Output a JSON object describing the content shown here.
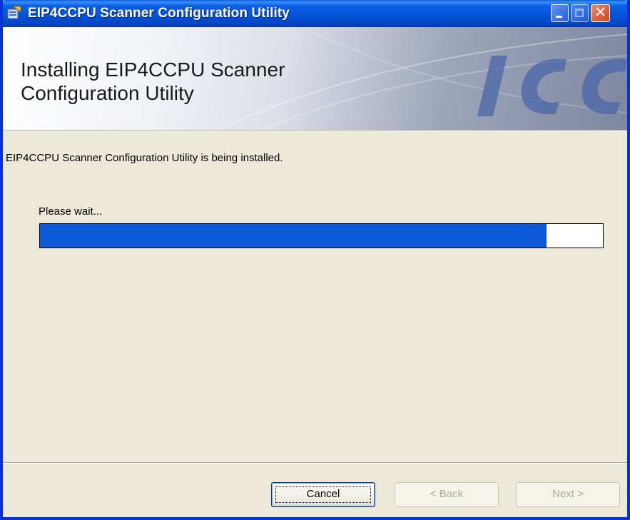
{
  "window": {
    "title": "EIP4CCPU Scanner Configuration Utility",
    "buttons": [
      "minimize",
      "maximize",
      "close"
    ]
  },
  "banner": {
    "title": "Installing EIP4CCPU Scanner Configuration Utility",
    "logo_icon": "icc-logo"
  },
  "body": {
    "status_text": "EIP4CCPU Scanner Configuration Utility is being installed.",
    "wait_label": "Please wait...",
    "progress_fraction": 0.9
  },
  "footer": {
    "cancel_label": "Cancel",
    "back_label": "< Back",
    "next_label": "Next >",
    "back_enabled": false,
    "next_enabled": false
  },
  "colors": {
    "titlebar": "#0453d5",
    "progress": "#0e59d8",
    "dialog": "#ece9d8"
  }
}
